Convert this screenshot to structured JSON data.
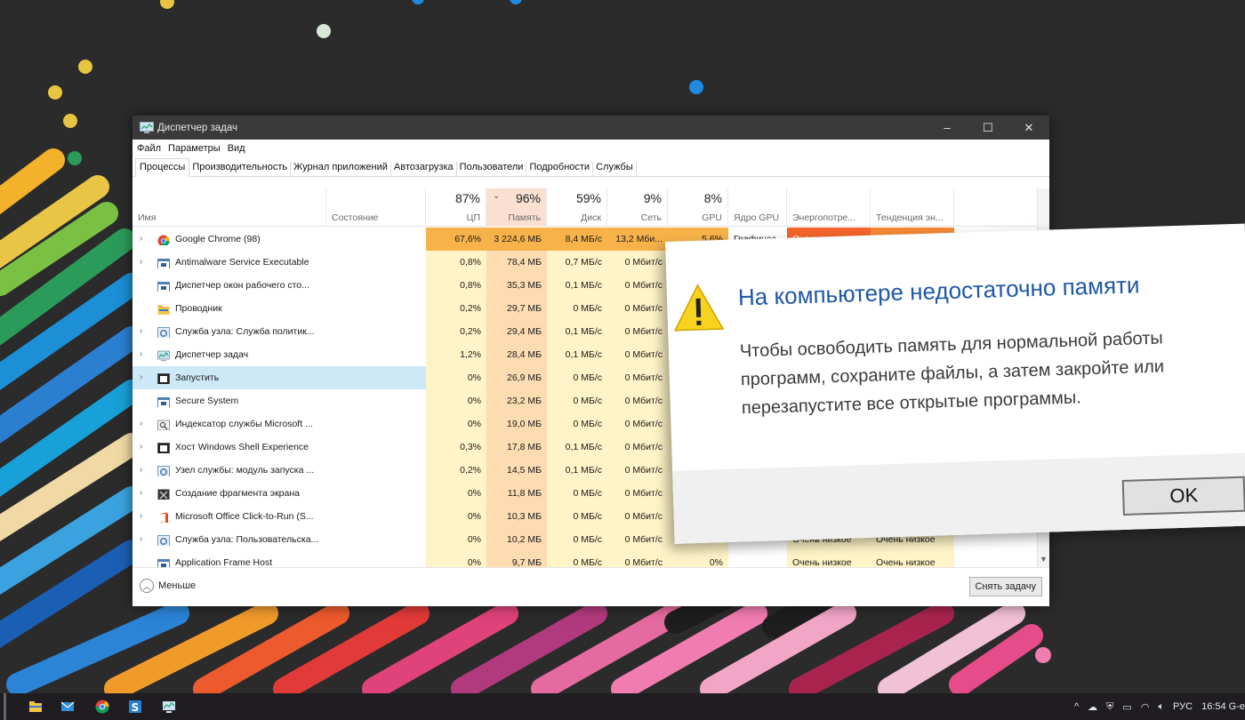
{
  "window": {
    "title": "Диспетчер задач",
    "minimize": "–",
    "maximize": "☐",
    "close": "✕"
  },
  "menu": [
    "Файл",
    "Параметры",
    "Вид"
  ],
  "tabs": [
    "Процессы",
    "Производительность",
    "Журнал приложений",
    "Автозагрузка",
    "Пользователи",
    "Подробности",
    "Службы"
  ],
  "columns": {
    "name": "Имя",
    "status": "Состояние",
    "cpu": {
      "pct": "87%",
      "label": "ЦП"
    },
    "memory": {
      "pct": "96%",
      "label": "Память"
    },
    "disk": {
      "pct": "59%",
      "label": "Диск"
    },
    "network": {
      "pct": "9%",
      "label": "Сеть"
    },
    "gpu": {
      "pct": "8%",
      "label": "GPU"
    },
    "gpu_engine": "Ядро GPU",
    "power": "Энергопотре...",
    "power_trend": "Тенденция эн..."
  },
  "processes": [
    {
      "name": "Google Chrome (98)",
      "icon": "chrome-icon",
      "expand": true,
      "cpu": "67,6%",
      "mem": "3 224,6 МБ",
      "disk": "8,4 МБ/с",
      "net": "13,2 Мби...",
      "gpu": "5,6%",
      "engine": "Графичес...",
      "power": "Очень высокое",
      "trend": "Высокий",
      "hot": true
    },
    {
      "name": "Antimalware Service Executable",
      "icon": "service-icon",
      "expand": true,
      "cpu": "0,8%",
      "mem": "78,4 МБ",
      "disk": "0,7 МБ/с",
      "net": "0 Мбит/с"
    },
    {
      "name": "Диспетчер окон рабочего сто...",
      "icon": "service-icon",
      "expand": false,
      "cpu": "0,8%",
      "mem": "35,3 МБ",
      "disk": "0,1 МБ/с",
      "net": "0 Мбит/с"
    },
    {
      "name": "Проводник",
      "icon": "folder-icon",
      "expand": false,
      "cpu": "0,2%",
      "mem": "29,7 МБ",
      "disk": "0 МБ/с",
      "net": "0 Мбит/с"
    },
    {
      "name": "Служба узла: Служба политик...",
      "icon": "gear-icon",
      "expand": true,
      "cpu": "0,2%",
      "mem": "29,4 МБ",
      "disk": "0,1 МБ/с",
      "net": "0 Мбит/с"
    },
    {
      "name": "Диспетчер задач",
      "icon": "taskmgr-icon",
      "expand": true,
      "cpu": "1,2%",
      "mem": "28,4 МБ",
      "disk": "0,1 МБ/с",
      "net": "0 Мбит/с"
    },
    {
      "name": "Запустить",
      "icon": "window-icon",
      "expand": true,
      "cpu": "0%",
      "mem": "26,9 МБ",
      "disk": "0 МБ/с",
      "net": "0 Мбит/с",
      "selected": true
    },
    {
      "name": "Secure System",
      "icon": "service-icon",
      "expand": false,
      "cpu": "0%",
      "mem": "23,2 МБ",
      "disk": "0 МБ/с",
      "net": "0 Мбит/с"
    },
    {
      "name": "Индексатор службы Microsoft ...",
      "icon": "search-icon",
      "expand": true,
      "cpu": "0%",
      "mem": "19,0 МБ",
      "disk": "0 МБ/с",
      "net": "0 Мбит/с"
    },
    {
      "name": "Хост Windows Shell Experience",
      "icon": "window-icon",
      "expand": true,
      "cpu": "0,3%",
      "mem": "17,8 МБ",
      "disk": "0,1 МБ/с",
      "net": "0 Мбит/с"
    },
    {
      "name": "Узел службы: модуль запуска ...",
      "icon": "gear-icon",
      "expand": true,
      "cpu": "0,2%",
      "mem": "14,5 МБ",
      "disk": "0,1 МБ/с",
      "net": "0 Мбит/с"
    },
    {
      "name": "Создание фрагмента экрана",
      "icon": "snip-icon",
      "expand": true,
      "cpu": "0%",
      "mem": "11,8 МБ",
      "disk": "0 МБ/с",
      "net": "0 Мбит/с"
    },
    {
      "name": "Microsoft Office Click-to-Run (S...",
      "icon": "office-icon",
      "expand": true,
      "cpu": "0%",
      "mem": "10,3 МБ",
      "disk": "0 МБ/с",
      "net": "0 Мбит/с"
    },
    {
      "name": "Служба узла: Пользовательска...",
      "icon": "gear-icon",
      "expand": true,
      "cpu": "0%",
      "mem": "10,2 МБ",
      "disk": "0 МБ/с",
      "net": "0 Мбит/с",
      "gpu": "0%",
      "power": "Очень низкое",
      "trend": "Очень низкое"
    },
    {
      "name": "Application Frame Host",
      "icon": "service-icon",
      "expand": false,
      "cpu": "0%",
      "mem": "9,7 МБ",
      "disk": "0 МБ/с",
      "net": "0 Мбит/с",
      "gpu": "0%",
      "power": "Очень низкое",
      "trend": "Очень низкое"
    }
  ],
  "footer": {
    "less": "Меньше",
    "end_task": "Снять задачу"
  },
  "dialog": {
    "title": "На компьютере недостаточно памяти",
    "body": "Чтобы освободить память для нормальной работы программ, сохраните файлы, а затем закройте или перезапустите все открытые программы.",
    "ok": "OK"
  },
  "taskbar": {
    "apps": [
      "file-explorer-icon",
      "mail-icon",
      "chrome-icon",
      "s-app-icon",
      "taskmgr-icon"
    ],
    "tray": {
      "chevron": "^",
      "lang": "РУС",
      "time": "16:54 G-e"
    }
  },
  "colors": {
    "hot_row": "#f7b24a",
    "power_very_high": "#f4652c",
    "trend_high": "#f58a35",
    "memory_col": "#fcdcb0",
    "dialog_title": "#1f57a6"
  }
}
